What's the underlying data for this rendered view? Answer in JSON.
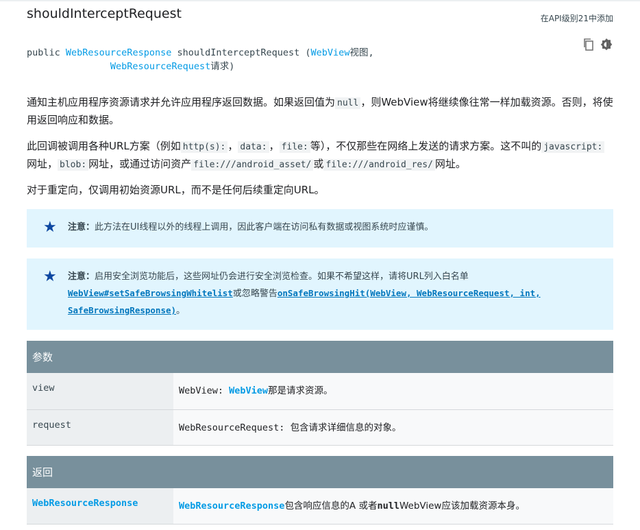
{
  "header": {
    "method_name": "shouldInterceptRequest",
    "api_note": "在API级别21中添加"
  },
  "signature": {
    "line1_prefix": "public ",
    "return_type": "WebResourceResponse",
    "method": " shouldInterceptRequest (",
    "param1_type": "WebView",
    "param1_name": "视图,",
    "indent": "               ",
    "param2_type": "WebResourceRequest",
    "param2_name": "请求)"
  },
  "icons": {
    "copy": "copy-icon",
    "theme": "dark-theme-icon"
  },
  "paragraphs": {
    "p1_a": "通知主机应用程序资源请求并允许应用程序返回数据。如果返回值为",
    "p1_code": "null",
    "p1_b": "，则WebView将继续像往常一样加载资源。否则，将使用返回响应和数据。",
    "p2_a": "此回调被调用各种URL方案（例如",
    "p2_code1": "http(s):",
    "p2_sep1": "，",
    "p2_code2": "data:",
    "p2_sep2": "，",
    "p2_code3": "file:",
    "p2_b": "等），不仅那些在网络上发送的请求方案。这不叫的",
    "p2_code4": "javascript:",
    "p2_c": "网址，",
    "p2_code5": "blob:",
    "p2_d": "网址，或通过访问资产",
    "p2_code6": "file:///android_asset/",
    "p2_e": "或",
    "p2_code7": "file:///android_res/",
    "p2_f": "网址。",
    "p3": "对于重定向，仅调用初始资源URL，而不是任何后续重定向URL。"
  },
  "notes": {
    "note1_label": "注意：",
    "note1_text": "此方法在UI线程以外的线程上调用，因此客户端在访问私有数据或视图系统时应谨慎。",
    "note2_label": "注意：",
    "note2_text_a": "启用安全浏览功能后，这些网址仍会进行安全浏览检查。如果不希望这样，请将URL列入白名单",
    "note2_link1": "WebView#setSafeBrowsingWhitelist",
    "note2_text_b": "或忽略警告",
    "note2_link2": "onSafeBrowsingHit(WebView, WebResourceRequest, int, SafeBrowsingResponse)",
    "note2_text_c": "。"
  },
  "params_table": {
    "header": "参数",
    "rows": [
      {
        "name": "view",
        "desc_type": "WebView: ",
        "desc_link": "WebView",
        "desc_text": "那是请求资源。"
      },
      {
        "name": "request",
        "desc_type": "WebResourceRequest: ",
        "desc_link": "",
        "desc_text": "包含请求详细信息的对象。"
      }
    ]
  },
  "returns_table": {
    "header": "返回",
    "type": "WebResourceResponse",
    "desc_link": "WebResourceResponse",
    "desc_text_a": "包含响应信息的A 或者",
    "desc_code": "null",
    "desc_text_b": "WebView应该加载资源本身。"
  }
}
